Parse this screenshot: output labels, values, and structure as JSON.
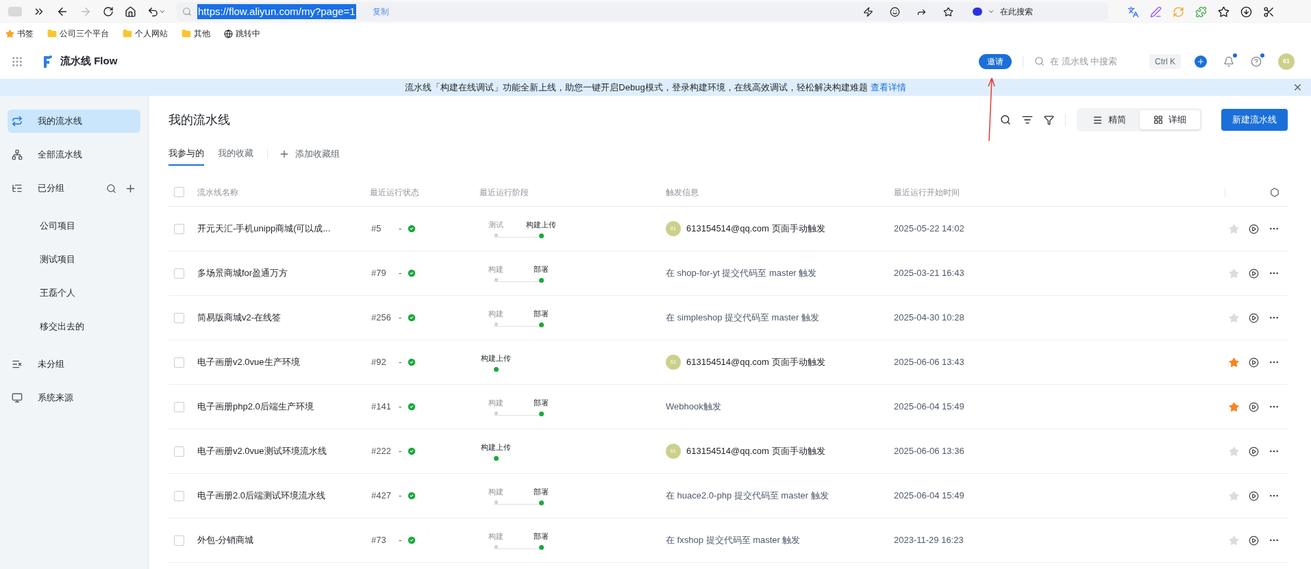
{
  "browser": {
    "url": "https://flow.aliyun.com/my?page=1",
    "copy_label": "复制",
    "search_placeholder": "在此搜索",
    "bookmarks": [
      {
        "label": "书签",
        "kind": "star"
      },
      {
        "label": "公司三个平台",
        "kind": "folder"
      },
      {
        "label": "个人网站",
        "kind": "folder"
      },
      {
        "label": "其他",
        "kind": "folder"
      },
      {
        "label": "跳转中",
        "kind": "globe"
      }
    ]
  },
  "header": {
    "product": "流水线 Flow",
    "invite": "邀请",
    "search_placeholder": "在 流水线 中搜索",
    "shortcut": "Ctrl K",
    "avatar": "61"
  },
  "banner": {
    "text": "流水线「构建在线调试」功能全新上线，助您一键开启Debug模式，登录构建环境，在线高效调试，轻松解决构建难题",
    "link": "查看详情"
  },
  "sidebar": {
    "items": [
      {
        "label": "我的流水线",
        "selected": true
      },
      {
        "label": "全部流水线",
        "selected": false
      },
      {
        "label": "已分组",
        "selected": false,
        "children": [
          {
            "label": "公司项目",
            "selected": false
          },
          {
            "label": "测试项目",
            "selected": false
          },
          {
            "label": "王磊个人",
            "selected": false
          },
          {
            "label": "移交出去的",
            "selected": false
          }
        ]
      },
      {
        "label": "未分组",
        "selected": false
      },
      {
        "label": "系统来源",
        "selected": false
      }
    ]
  },
  "page": {
    "title": "我的流水线",
    "views": [
      {
        "label": "精简",
        "selected": false
      },
      {
        "label": "详细",
        "selected": true
      }
    ],
    "new_button": "新建流水线",
    "tabs": [
      {
        "label": "我参与的",
        "selected": true
      },
      {
        "label": "我的收藏",
        "selected": false
      }
    ],
    "add_group": "添加收藏组"
  },
  "table": {
    "select_all": false,
    "columns": [
      "流水线名称",
      "最近运行状态",
      "最近运行阶段",
      "触发信息",
      "最近运行开始时间"
    ],
    "rows": [
      {
        "checked": false,
        "name": "开元天汇-手机unipp商城(可以成...",
        "run": "#5",
        "status": "-",
        "stages": [
          {
            "label": "测试",
            "passed": false
          },
          {
            "label": "构建上传",
            "passed": true
          }
        ],
        "trigger": {
          "kind": "manual",
          "avatar": "61",
          "text": "613154514@qq.com 页面手动触发"
        },
        "time": "2025-05-22 14:02",
        "starred": false
      },
      {
        "checked": false,
        "name": "多场景商城for盈通万方",
        "run": "#79",
        "status": "-",
        "stages": [
          {
            "label": "构建",
            "passed": false
          },
          {
            "label": "部署",
            "passed": true
          }
        ],
        "trigger": {
          "kind": "text",
          "text": "在 shop-for-yt 提交代码至 master 触发"
        },
        "time": "2025-03-21 16:43",
        "starred": false
      },
      {
        "checked": false,
        "name": "简易版商城v2-在线签",
        "run": "#256",
        "status": "-",
        "stages": [
          {
            "label": "构建",
            "passed": false
          },
          {
            "label": "部署",
            "passed": true
          }
        ],
        "trigger": {
          "kind": "text",
          "text": "在 simpleshop 提交代码至 master 触发"
        },
        "time": "2025-04-30 10:28",
        "starred": false
      },
      {
        "checked": false,
        "name": "电子画册v2.0vue生产环境",
        "run": "#92",
        "status": "-",
        "stages": [
          {
            "label": "构建上传",
            "passed": true
          }
        ],
        "trigger": {
          "kind": "manual",
          "avatar": "61",
          "text": "613154514@qq.com 页面手动触发"
        },
        "time": "2025-06-06 13:43",
        "starred": true
      },
      {
        "checked": false,
        "name": "电子画册php2.0后端生产环境",
        "run": "#141",
        "status": "-",
        "stages": [
          {
            "label": "构建",
            "passed": false
          },
          {
            "label": "部署",
            "passed": true
          }
        ],
        "trigger": {
          "kind": "text",
          "text": "Webhook触发"
        },
        "time": "2025-06-04 15:49",
        "starred": true
      },
      {
        "checked": false,
        "name": "电子画册v2.0vue测试环境流水线",
        "run": "#222",
        "status": "-",
        "stages": [
          {
            "label": "构建上传",
            "passed": true
          }
        ],
        "trigger": {
          "kind": "manual",
          "avatar": "61",
          "text": "613154514@qq.com 页面手动触发"
        },
        "time": "2025-06-06 13:36",
        "starred": false
      },
      {
        "checked": false,
        "name": "电子画册2.0后端测试环境流水线",
        "run": "#427",
        "status": "-",
        "stages": [
          {
            "label": "构建",
            "passed": false
          },
          {
            "label": "部署",
            "passed": true
          }
        ],
        "trigger": {
          "kind": "text",
          "text": "在 huace2.0-php 提交代码至 master 触发"
        },
        "time": "2025-06-04 15:49",
        "starred": false
      },
      {
        "checked": false,
        "name": "外包-分销商城",
        "run": "#73",
        "status": "-",
        "stages": [
          {
            "label": "构建",
            "passed": false
          },
          {
            "label": "部署",
            "passed": true
          }
        ],
        "trigger": {
          "kind": "text",
          "text": "在 fxshop 提交代码至 master 触发"
        },
        "time": "2023-11-29 16:23",
        "starred": false
      }
    ]
  }
}
